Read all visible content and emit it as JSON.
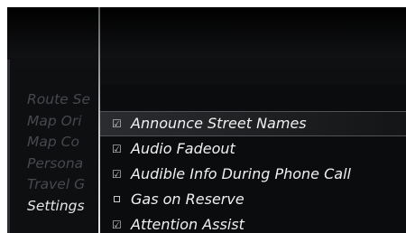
{
  "left_menu": {
    "items": [
      {
        "label": "Route Se"
      },
      {
        "label": "Map Ori"
      },
      {
        "label": "Map Co"
      },
      {
        "label": "Persona"
      },
      {
        "label": "Travel G"
      },
      {
        "label": "Settings",
        "active": true
      }
    ]
  },
  "submenu": {
    "items": [
      {
        "label": "Announce Street Names",
        "checked": true,
        "highlighted": true
      },
      {
        "label": "Audio Fadeout",
        "checked": true
      },
      {
        "label": "Audible Info During Phone Call",
        "checked": true
      },
      {
        "label": "Gas on Reserve",
        "checked": false
      },
      {
        "label": "Attention Assist",
        "checked": true
      }
    ],
    "icons": {
      "checked": "checkbox-checked-icon",
      "unchecked": "checkbox-empty-icon"
    }
  },
  "colors": {
    "background": "#0e0f11",
    "inactive_text": "#45484d",
    "active_text": "#e6e7e9",
    "highlight": "#2a2c2f"
  }
}
